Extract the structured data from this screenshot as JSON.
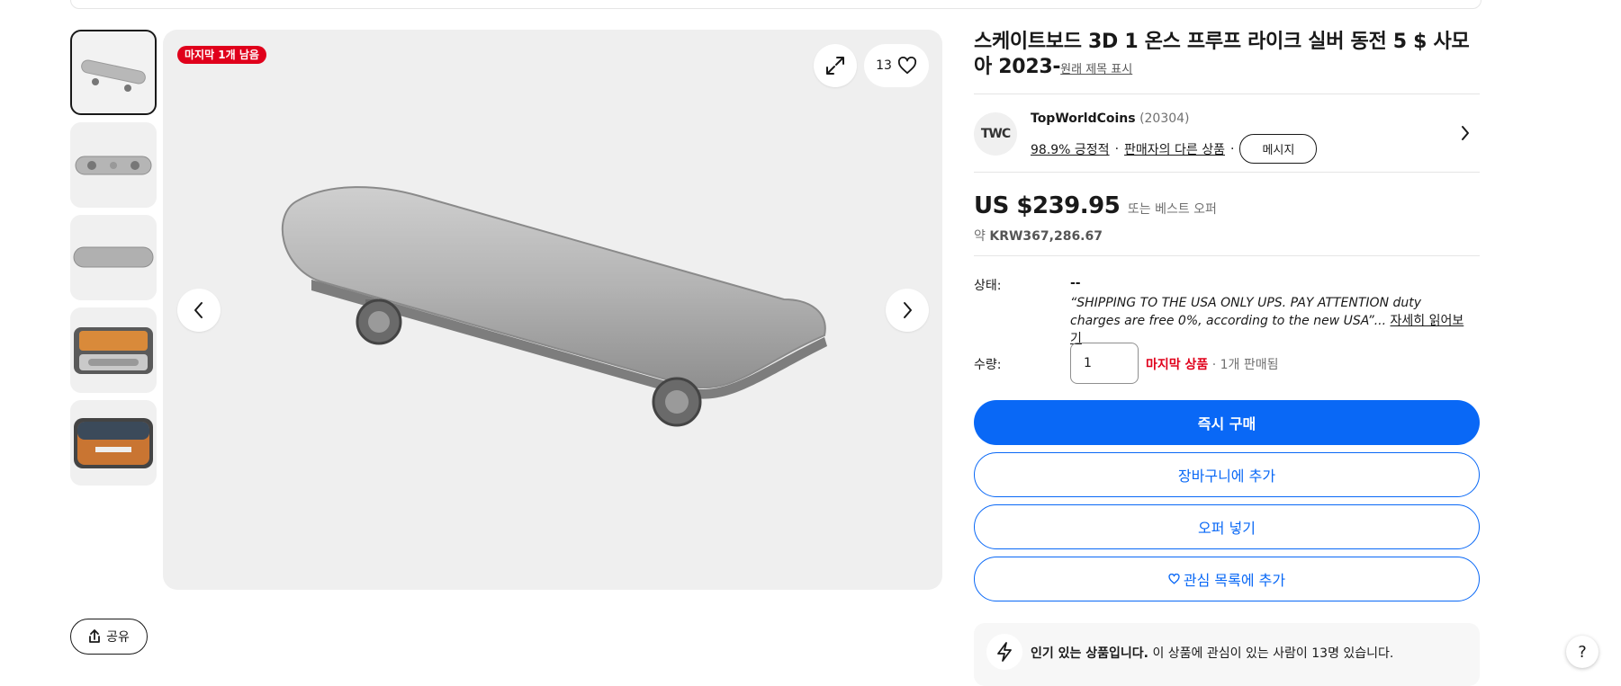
{
  "badge": "마지막 1개 남음",
  "watch_count": "13",
  "share_label": "공유",
  "title": "스케이트보드 3D 1 온스 프루프 라이크 실버 동전 5 $ 사모아 2023-",
  "original_title_link": "원래 제목 표시",
  "seller": {
    "avatar_text": "TWC",
    "name": "TopWorldCoins",
    "count": "(20304)",
    "positive": "98.9% 긍정적",
    "sep1": "·",
    "other_items": "판매자의 다른 상품",
    "sep2": "·",
    "message": "메시지"
  },
  "price": {
    "main": "US $239.95",
    "or_best_offer": "또는 베스트 오퍼",
    "approx_prefix": "약",
    "approx_value": "KRW367,286.67"
  },
  "condition": {
    "label": "상태:",
    "value": "--",
    "description": "“SHIPPING TO THE USA ONLY UPS. PAY ATTENTION duty charges are free 0%, according to the new USA”...",
    "read_more": "자세히 읽어보기"
  },
  "quantity": {
    "label": "수량:",
    "value": "1",
    "last_item": "마지막 상품",
    "sold": "· 1개 판매됨"
  },
  "buttons": {
    "buy_now": "즉시 구매",
    "add_to_cart": "장바구니에 추가",
    "make_offer": "오퍼 넣기",
    "add_to_watchlist": "관심 목록에 추가"
  },
  "popular": {
    "bold": "인기 있는 상품입니다.",
    "text": " 이 상품에 관심이 있는 사람이 13명 있습니다."
  },
  "help": "?",
  "icons": {
    "expand": "expand-icon",
    "heart": "heart-icon",
    "prev": "chevron-left-icon",
    "next": "chevron-right-icon",
    "share": "share-icon",
    "seller_chevron": "chevron-right-icon",
    "lightning": "lightning-icon"
  }
}
